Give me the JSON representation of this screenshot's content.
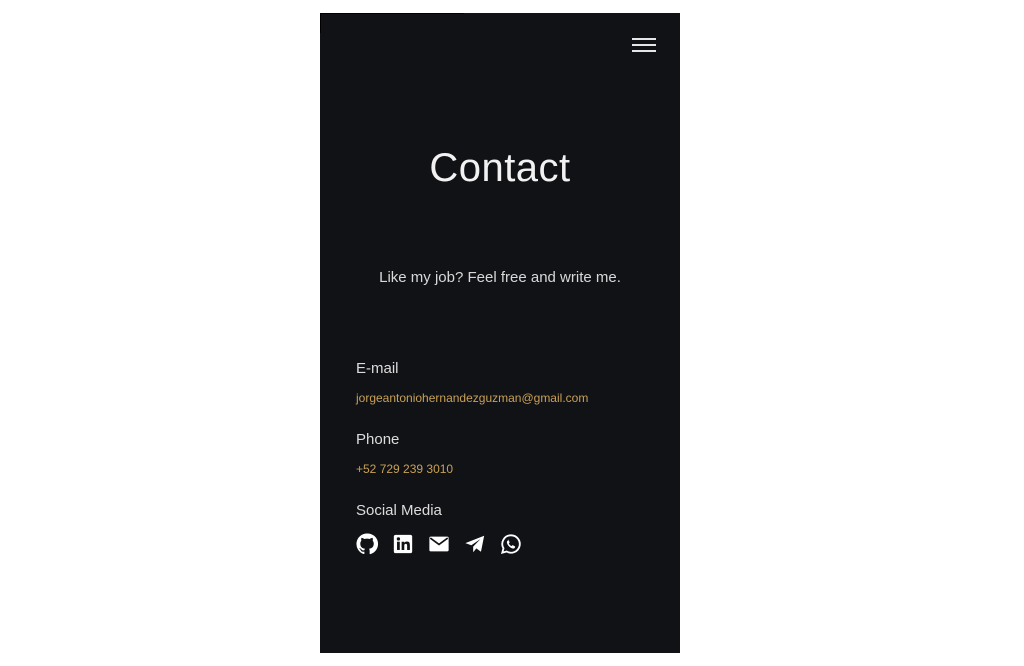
{
  "page": {
    "title": "Contact",
    "subtitle": "Like my job? Feel free and write me."
  },
  "contact": {
    "email_label": "E-mail",
    "email_value": "jorgeantoniohernandezguzman@gmail.com",
    "phone_label": "Phone",
    "phone_value": "+52 729 239 3010",
    "social_label": "Social Media"
  },
  "social_icons": [
    "github-icon",
    "linkedin-icon",
    "email-icon",
    "telegram-icon",
    "whatsapp-icon"
  ],
  "colors": {
    "background": "#111216",
    "accent": "#c8a055",
    "text": "#dcdcdc",
    "title": "#f2f2f2"
  }
}
